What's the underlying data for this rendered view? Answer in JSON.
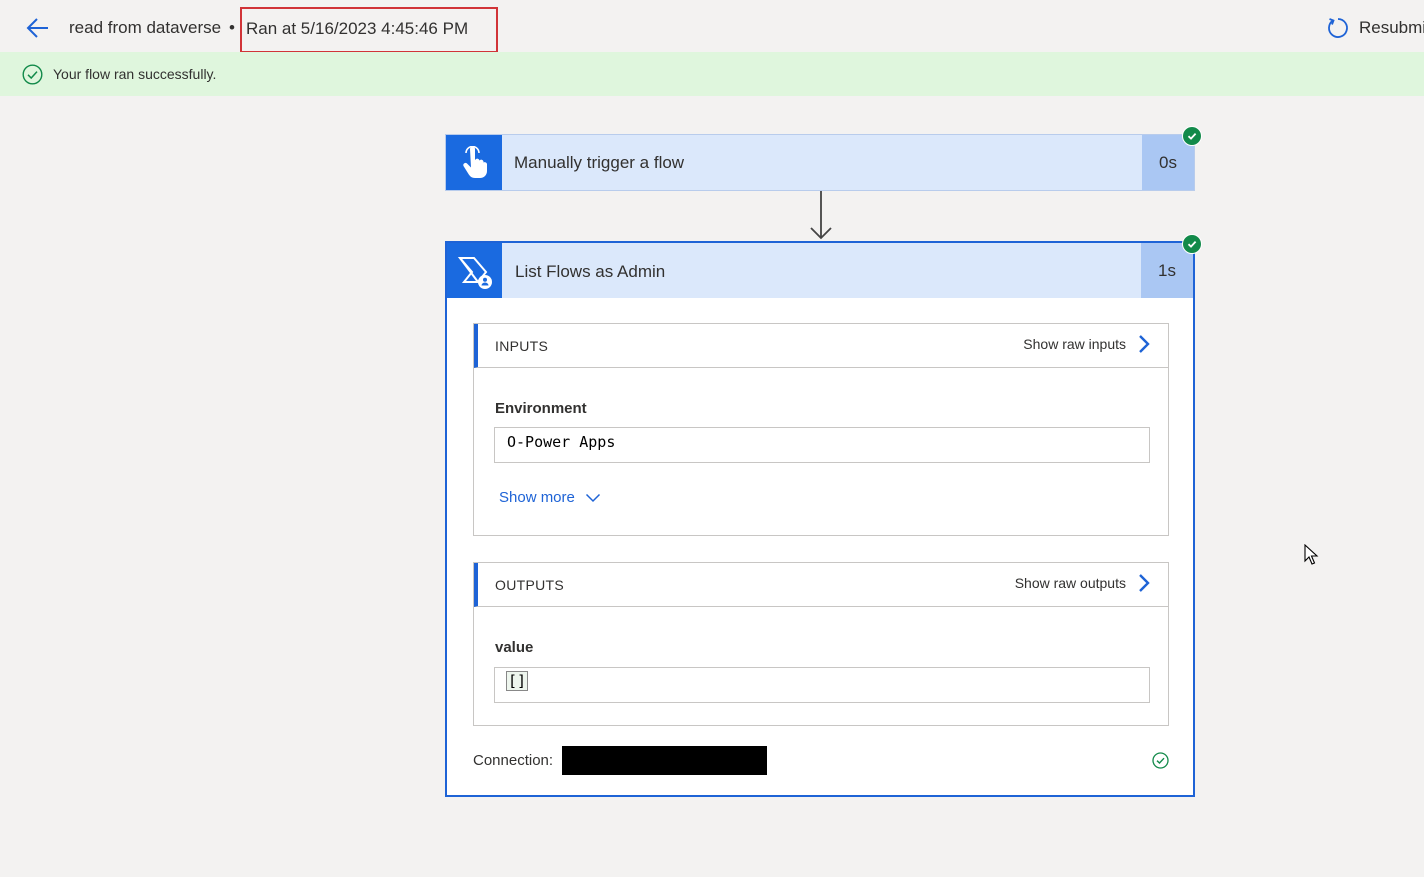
{
  "header": {
    "flow_name": "read from dataverse",
    "separator": "•",
    "ran_at": "Ran at 5/16/2023 4:45:46 PM",
    "resubmit_label": "Resubmi"
  },
  "banner": {
    "message": "Your flow ran successfully."
  },
  "trigger": {
    "title": "Manually trigger a flow",
    "duration": "0s",
    "status": "succeeded"
  },
  "action": {
    "title": "List Flows as Admin",
    "duration": "1s",
    "status": "succeeded",
    "inputs": {
      "label": "INPUTS",
      "show_raw_label": "Show raw inputs",
      "fields": [
        {
          "label": "Environment",
          "value": "O-Power Apps"
        }
      ],
      "show_more_label": "Show more"
    },
    "outputs": {
      "label": "OUTPUTS",
      "show_raw_label": "Show raw outputs",
      "fields": [
        {
          "label": "value",
          "value": "[]"
        }
      ]
    },
    "connection_label": "Connection:"
  },
  "colors": {
    "accent": "#1e63d6",
    "success": "#128a4a",
    "banner_bg": "#dff6dd",
    "card_header_bg": "#dbe8fb",
    "highlight_box": "#d13438"
  },
  "icons": {
    "back": "back-arrow-icon",
    "resubmit": "refresh-icon",
    "success": "check-circle-icon",
    "trigger": "touch-hand-icon",
    "action": "power-automate-admin-icon",
    "chevron_right": "chevron-right-icon",
    "chevron_down": "chevron-down-icon"
  }
}
